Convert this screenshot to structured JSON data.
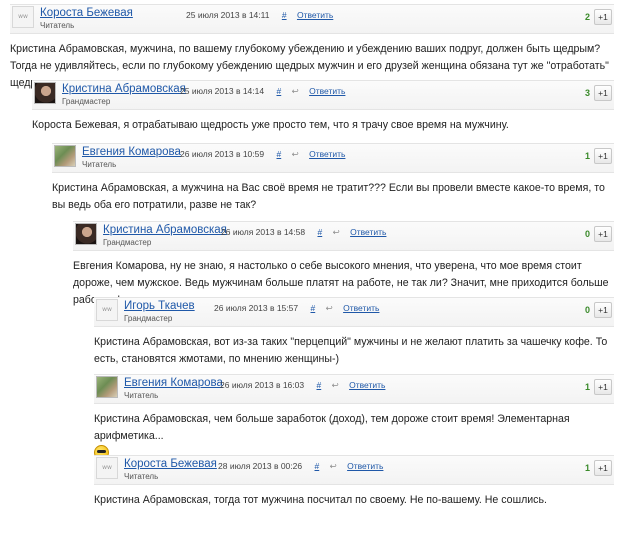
{
  "comments": [
    {
      "author": "Короста Бежевая",
      "role": "Читатель",
      "date": "25 июля 2013 в 14:11",
      "hash": "#",
      "reply_icon": "",
      "reply": "Ответить",
      "score": "2",
      "plus": "+1",
      "avatar": "ww-placeholder-icon",
      "text": "Кристина Абрамовская, мужчина, по вашему глубокому убеждению и убеждению ваших подруг, должен быть щедрым? Тогда не удивляйтесь, если по глубокому убеждению щедрых мужчин и его друзей женщина обязана тут же \"отработать\" щедрость."
    },
    {
      "author": "Кристина Абрамовская",
      "role": "Грандмастер",
      "date": "25 июля 2013 в 14:14",
      "hash": "#",
      "reply_icon": "↩",
      "reply": "Ответить",
      "score": "3",
      "plus": "+1",
      "avatar": "user-photo",
      "text": "Короста Бежевая, я отрабатываю щедрость уже просто тем, что я трачу свое время на мужчину."
    },
    {
      "author": "Евгения Комарова",
      "role": "Читатель",
      "date": "26 июля 2013 в 10:59",
      "hash": "#",
      "reply_icon": "↩",
      "reply": "Ответить",
      "score": "1",
      "plus": "+1",
      "avatar": "user-photo",
      "text": "Кристина Абрамовская, а мужчина на Вас своё время не тратит??? Если вы провели вместе какое-то время, то вы ведь оба его потратили, разве не так?"
    },
    {
      "author": "Кристина Абрамовская",
      "role": "Грандмастер",
      "date": "26 июля 2013 в 14:58",
      "hash": "#",
      "reply_icon": "↩",
      "reply": "Ответить",
      "score": "0",
      "plus": "+1",
      "avatar": "user-photo",
      "text": "Евгения Комарова, ну не знаю, я настолько о себе высокого мнения, что уверена, что мое время стоит дороже, чем мужское. Ведь мужчинам больше платят на работе, не так ли? Значит, мне приходится больше работать!"
    },
    {
      "author": "Игорь Ткачев",
      "role": "Грандмастер",
      "date": "26 июля 2013 в 15:57",
      "hash": "#",
      "reply_icon": "↩",
      "reply": "Ответить",
      "score": "0",
      "plus": "+1",
      "avatar": "ww-placeholder-icon",
      "text": "Кристина Абрамовская, вот из-за таких \"перцепций\" мужчины и не желают платить за чашечку кофе. То есть, становятся жмотами, по мнению женщины-)"
    },
    {
      "author": "Евгения Комарова",
      "role": "Читатель",
      "date": "26 июля 2013 в 16:03",
      "hash": "#",
      "reply_icon": "↩",
      "reply": "Ответить",
      "score": "1",
      "plus": "+1",
      "avatar": "user-photo",
      "text": "Кристина Абрамовская, чем больше заработок (доход), тем дороже стоит время! Элементарная арифметика..."
    },
    {
      "author": "Короста Бежевая",
      "role": "Читатель",
      "date": "28 июля 2013 в 00:26",
      "hash": "#",
      "reply_icon": "↩",
      "reply": "Ответить",
      "score": "1",
      "plus": "+1",
      "avatar": "ww-placeholder-icon",
      "text": "Кристина Абрамовская, тогда тот мужчина посчитал по своему. Не по-вашему. Не сошлись."
    }
  ],
  "avatar_placeholder_text": "ww",
  "colors": {
    "link": "#1f58a8",
    "score": "#3a8a2a"
  }
}
